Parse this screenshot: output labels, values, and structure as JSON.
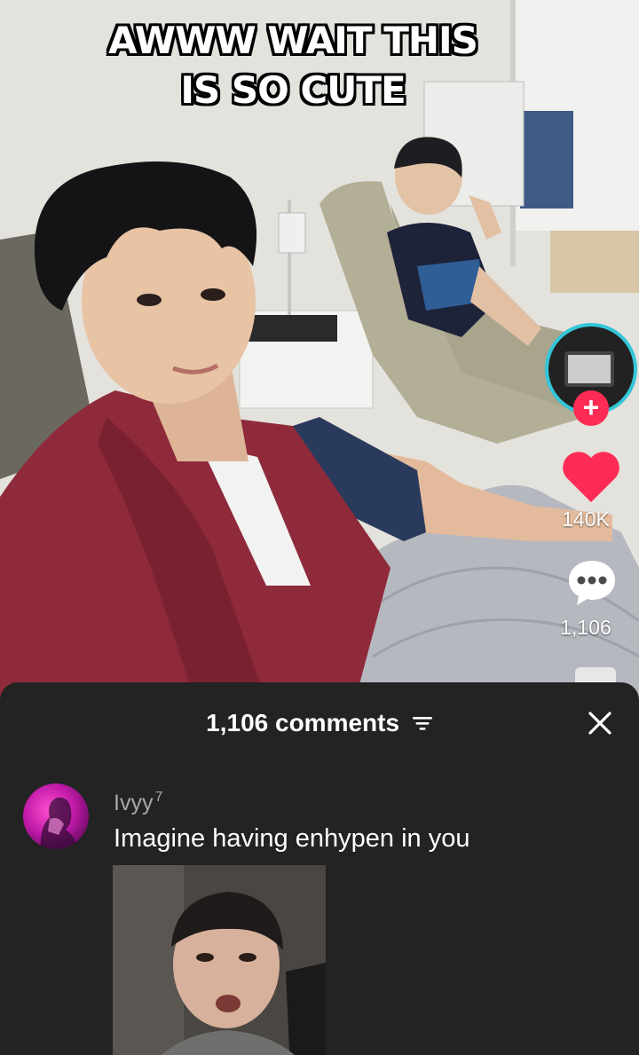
{
  "video": {
    "caption_line1": "AWWW WAIT THIS",
    "caption_line2": "IS SO CUTE"
  },
  "actions": {
    "like_count": "140K",
    "comment_count": "1,106",
    "follow_symbol": "+",
    "icons": [
      "creator-avatar",
      "plus-icon",
      "heart-icon",
      "comment-bubble-icon",
      "share-icon"
    ]
  },
  "comments_sheet": {
    "title": "1,106 comments",
    "icons": [
      "filter-icon",
      "close-icon"
    ],
    "comments": [
      {
        "username": "Ivyy",
        "badge": "7",
        "text": "Imagine having enhypen in you"
      }
    ]
  },
  "colors": {
    "sheet_bg": "#232323",
    "like_red": "#fe2c55",
    "ring_cyan": "#34c6d8",
    "username_gray": "#a8a8a8"
  }
}
